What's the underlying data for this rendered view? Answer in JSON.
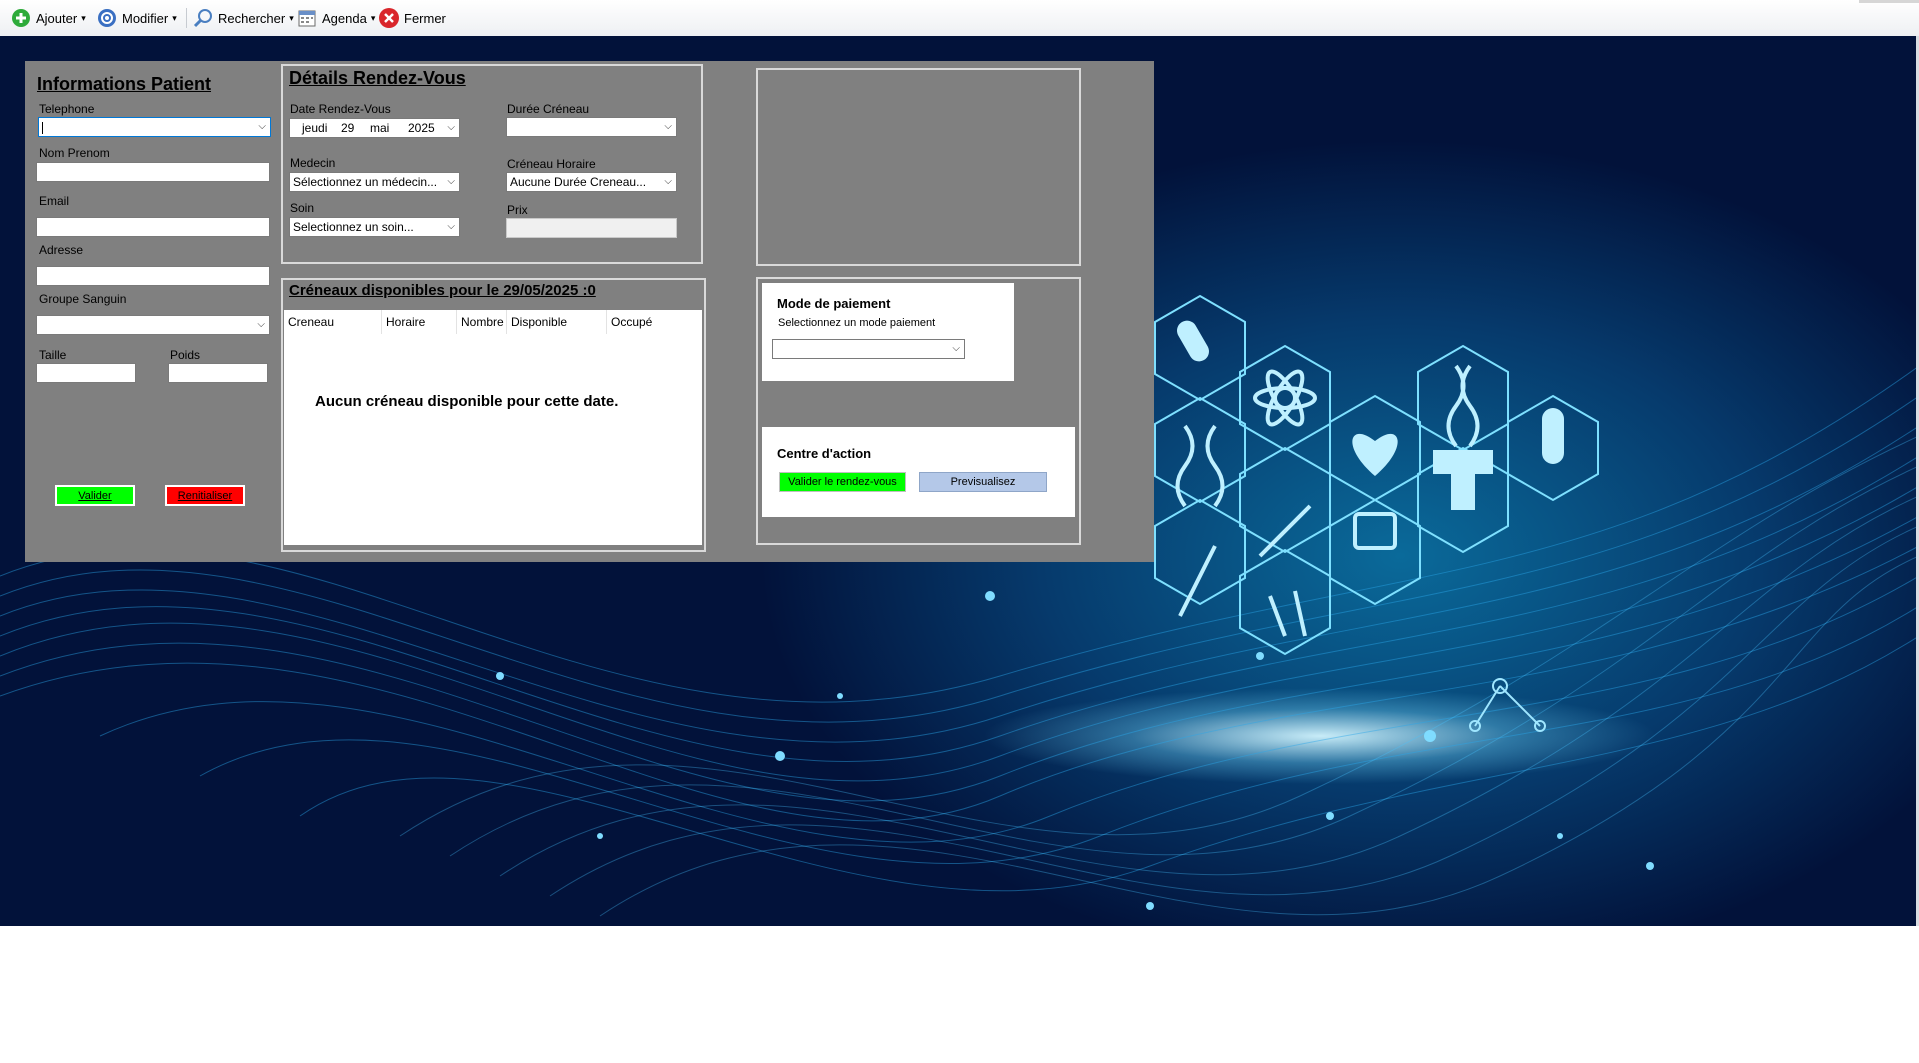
{
  "toolbar": {
    "items": [
      {
        "label": "Ajouter",
        "icon": "add-icon",
        "dropdown": true
      },
      {
        "label": "Modifier",
        "icon": "edit-icon",
        "dropdown": true
      },
      {
        "label": "Rechercher",
        "icon": "search-icon",
        "dropdown": true
      },
      {
        "label": "Agenda",
        "icon": "calendar-icon",
        "dropdown": true
      },
      {
        "label": "Fermer",
        "icon": "close-icon",
        "dropdown": false
      }
    ]
  },
  "patient": {
    "title": "Informations Patient",
    "telephone_label": "Telephone",
    "telephone_value": "",
    "nom_label": "Nom Prenom",
    "email_label": "Email",
    "adresse_label": "Adresse",
    "groupe_label": "Groupe Sanguin",
    "taille_label": "Taille",
    "poids_label": "Poids",
    "valider_label": "Valider",
    "reinit_label": "Renitialiser"
  },
  "rdv": {
    "title": "Détails Rendez-Vous",
    "date_label": "Date Rendez-Vous",
    "date_day": "jeudi",
    "date_num": "29",
    "date_month": "mai",
    "date_year": "2025",
    "duree_label": "Durée Créneau",
    "medecin_label": "Medecin",
    "medecin_value": "Sélectionnez un médecin...",
    "creneau_label": "Créneau Horaire",
    "creneau_value": "Aucune Durée Creneau...",
    "soin_label": "Soin",
    "soin_value": "Selectionnez un soin...",
    "prix_label": "Prix"
  },
  "slots": {
    "title": "Créneaux disponibles pour le 29/05/2025 :0",
    "columns": [
      "Creneau",
      "Horaire",
      "Nombre",
      "Disponible",
      "Occupé"
    ],
    "empty_message": "Aucun créneau disponible pour cette date."
  },
  "payment": {
    "title": "Mode de paiement",
    "subtitle": "Selectionnez un mode paiement"
  },
  "actions": {
    "title": "Centre d'action",
    "validate_label": "Valider le rendez-vous",
    "preview_label": "Previsualisez"
  },
  "colors": {
    "panel": "#808080",
    "valider": "#00ff00",
    "reinit": "#ff0000",
    "preview": "#b4c8e8"
  }
}
